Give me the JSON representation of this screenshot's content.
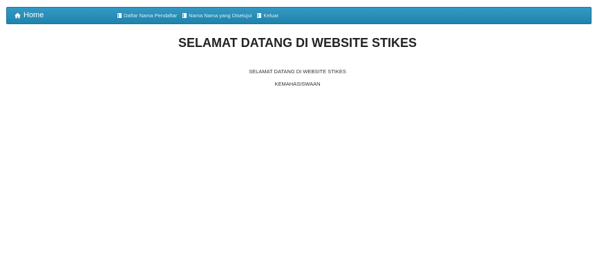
{
  "navbar": {
    "brand_label": "Home",
    "brand_icon": "home-icon",
    "items": [
      {
        "label": "Daftar Nama Pendaftar",
        "icon": "book-icon"
      },
      {
        "label": "Nama Nama yang Disetujui",
        "icon": "book-icon"
      },
      {
        "label": "Keluar",
        "icon": "book-icon"
      }
    ]
  },
  "main": {
    "title": "SELAMAT DATANG DI WEBSITE STIKES",
    "line1": "SELAMAT DATANG DI WEBSITE STIKES",
    "line2": "KEMAHASISWAAN"
  },
  "colors": {
    "navbar_bg": "#2a8fbb",
    "navbar_text": "#ffffff"
  }
}
